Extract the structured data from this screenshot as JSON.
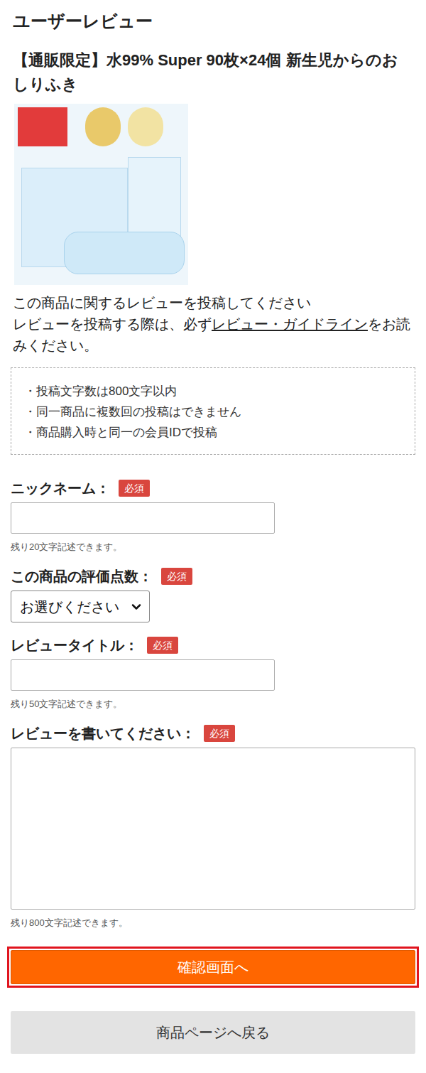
{
  "page": {
    "heading": "ユーザーレビュー"
  },
  "product": {
    "title": "【通販限定】水99% Super 90枚×24個 新生児からのおしりふき"
  },
  "intro": {
    "line1": "この商品に関するレビューを投稿してください",
    "before_link": "レビューを投稿する際は、必ず",
    "link": "レビュー・ガイドライン",
    "after_link": "をお読みください。"
  },
  "rules": [
    "・投稿文字数は800文字以内",
    "・同一商品に複数回の投稿はできません",
    "・商品購入時と同一の会員IDで投稿"
  ],
  "fields": [
    {
      "kind": "input",
      "label": "ニックネーム：",
      "badge": "必須",
      "value": "",
      "hint": "残り20文字記述できます。"
    },
    {
      "kind": "select",
      "label": "この商品の評価点数：",
      "badge": "必須",
      "value": "お選びください",
      "hint": ""
    },
    {
      "kind": "input",
      "label": "レビュータイトル：",
      "badge": "必須",
      "value": "",
      "hint": "残り50文字記述できます。"
    },
    {
      "kind": "textarea",
      "label": "レビューを書いてください：",
      "badge": "必須",
      "value": "",
      "hint": "残り800文字記述できます。"
    }
  ],
  "buttons": {
    "confirm": {
      "label": "確認画面へ",
      "highlighted": true
    },
    "back": {
      "label": "商品ページへ戻る"
    }
  }
}
